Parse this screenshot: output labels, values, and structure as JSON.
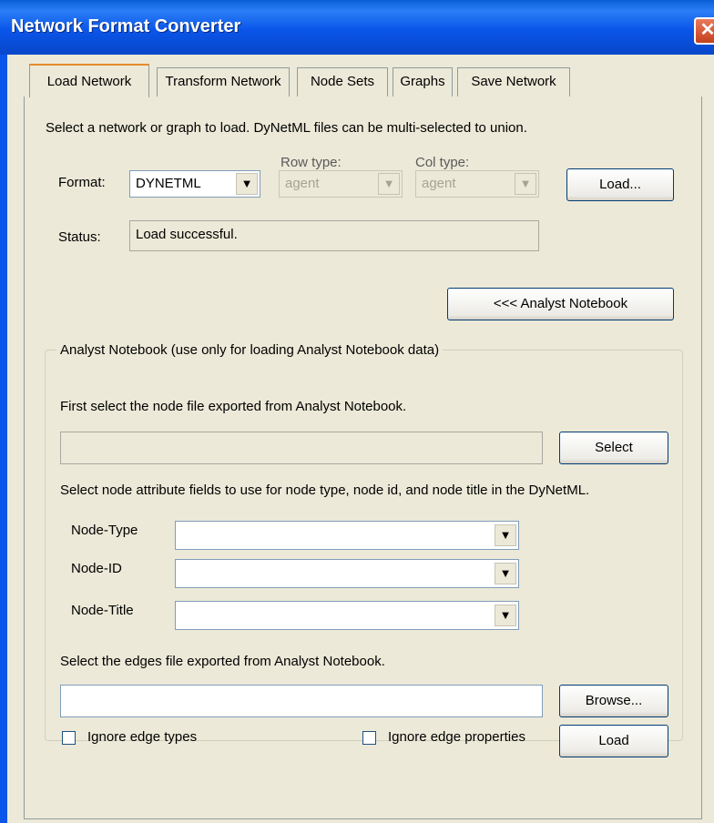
{
  "window": {
    "title": "Network Format Converter",
    "close_glyph": "✕"
  },
  "tabs": [
    {
      "label": "Load Network",
      "active": true
    },
    {
      "label": "Transform Network"
    },
    {
      "label": "Node Sets"
    },
    {
      "label": "Graphs"
    },
    {
      "label": "Save Network"
    }
  ],
  "load": {
    "instructions": "Select a network or graph to load.  DyNetML files can be multi-selected to union.",
    "format_label": "Format:",
    "format_value": "DYNETML",
    "row_type_label": "Row type:",
    "row_type_value": "agent",
    "col_type_label": "Col type:",
    "col_type_value": "agent",
    "load_button": "Load...",
    "status_label": "Status:",
    "status_value": "Load successful.",
    "analyst_button": "<<< Analyst Notebook"
  },
  "analyst": {
    "group_title": "Analyst Notebook (use only for loading Analyst Notebook data)",
    "node_file_instructions": "First select the node file exported from Analyst Notebook.",
    "node_file_value": "",
    "select_button": "Select",
    "attr_instructions": "Select node attribute fields to use for node type, node id, and node title in the DyNetML.",
    "node_type_label": "Node-Type",
    "node_id_label": "Node-ID",
    "node_title_label": "Node-Title",
    "edges_instructions": "Select the edges file exported from Analyst Notebook.",
    "edges_file_value": "",
    "browse_button": "Browse...",
    "ignore_edge_types": "Ignore edge types",
    "ignore_edge_properties": "Ignore edge properties",
    "load_button": "Load"
  },
  "icons": {
    "dropdown": "▼"
  }
}
